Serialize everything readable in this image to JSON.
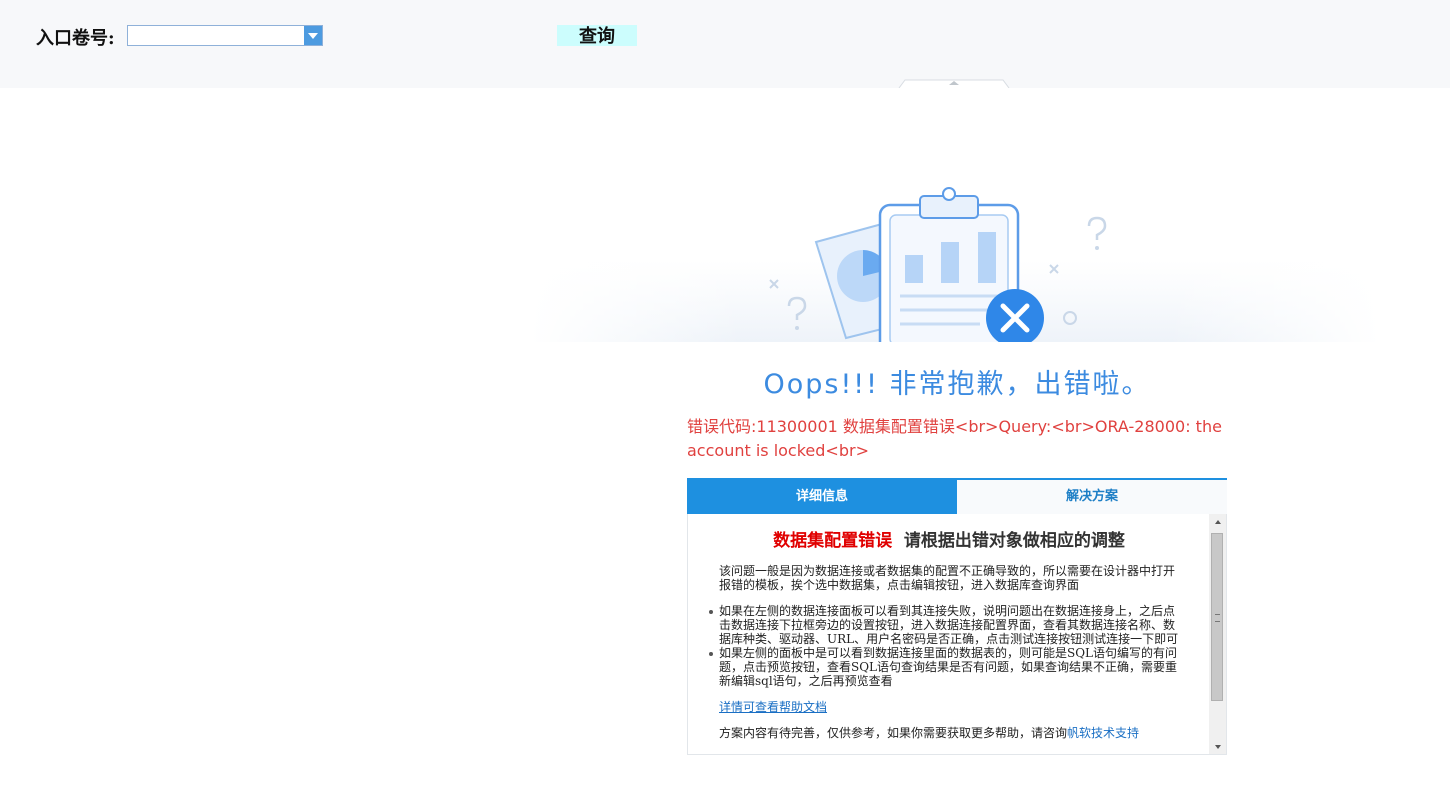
{
  "query_bar": {
    "volume_label": "入口卷号:",
    "volume_value": "",
    "query_button": "查询"
  },
  "error_page": {
    "title": "Oops!!! 非常抱歉，出错啦。",
    "message": "错误代码:11300001 数据集配置错误<br>Query:<br>ORA-28000: the account is locked<br>",
    "tabs": [
      {
        "label": "详细信息",
        "active": true
      },
      {
        "label": "解决方案",
        "active": false
      }
    ],
    "detail": {
      "heading_red": "数据集配置错误",
      "heading_rest": "请根据出错对象做相应的调整",
      "intro": "该问题一般是因为数据连接或者数据集的配置不正确导致的，所以需要在设计器中打开报错的模板，挨个选中数据集，点击编辑按钮，进入数据库查询界面",
      "bullets": [
        "如果在左侧的数据连接面板可以看到其连接失败，说明问题出在数据连接身上，之后点击数据连接下拉框旁边的设置按钮，进入数据连接配置界面，查看其数据连接名称、数据库种类、驱动器、URL、用户名密码是否正确，点击测试连接按钮测试连接一下即可",
        "如果左侧的面板中是可以看到数据连接里面的数据表的，则可能是SQL语句编写的有问题，点击预览按钮，查看SQL语句查询结果是否有问题，如果查询结果不正确，需要重新编辑sql语句，之后再预览查看"
      ],
      "help_link": "详情可查看帮助文档",
      "note_prefix": "方案内容有待完善，仅供参考，如果你需要获取更多帮助，请咨询",
      "note_link": "帆软技术支持"
    }
  },
  "colors": {
    "accent": "#1e90e0",
    "title": "#3c8be0",
    "error": "#e0413f",
    "heading_red": "#e00000",
    "query_button_bg": "#ccfdfd"
  },
  "icons": [
    "dropdown-arrow-icon",
    "collapse-arrow-icon",
    "error-x-icon",
    "pie-chart-icon",
    "bar-chart-icon",
    "clipboard-icon",
    "question-mark-icon",
    "scroll-up-icon",
    "scroll-down-icon"
  ]
}
